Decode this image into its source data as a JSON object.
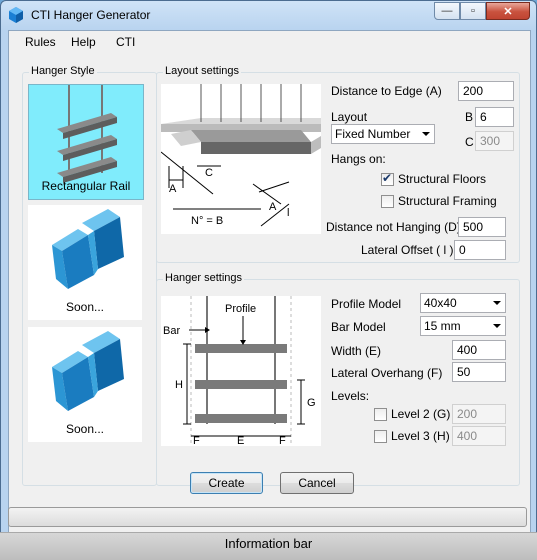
{
  "window": {
    "title": "CTI Hanger Generator",
    "icons": [
      "app-icon",
      "minimize-icon",
      "maximize-icon",
      "close-icon"
    ]
  },
  "menu": {
    "items": [
      "Rules",
      "Help",
      "CTI"
    ]
  },
  "hanger_style": {
    "title": "Hanger Style",
    "tiles": [
      {
        "label": "Rectangular Rail",
        "selected": true
      },
      {
        "label": "Soon...",
        "selected": false
      },
      {
        "label": "Soon...",
        "selected": false
      }
    ],
    "selected_color": "#80ecfc"
  },
  "layout": {
    "title": "Layout settings",
    "diagram_labels": {
      "a1": "A",
      "c": "C",
      "nb": "N° = B",
      "a2": "A",
      "l": "l"
    },
    "distance_edge_label": "Distance to Edge (A)",
    "distance_edge_value": "200",
    "layout_label": "Layout",
    "layout_value": "Fixed Number",
    "b_label": "B",
    "b_value": "6",
    "c_label": "C",
    "c_value": "300",
    "hangs_on_label": "Hangs on:",
    "structural_floors_label": "Structural Floors",
    "structural_floors_checked": true,
    "structural_framing_label": "Structural Framing",
    "structural_framing_checked": false,
    "distance_not_hanging_label": "Distance not Hanging (D)",
    "distance_not_hanging_value": "500",
    "lateral_offset_label": "Lateral Offset ( l )",
    "lateral_offset_value": "0"
  },
  "hanger": {
    "title": "Hanger settings",
    "diagram_labels": {
      "bar": "Bar",
      "profile": "Profile",
      "h": "H",
      "g": "G",
      "f1": "F",
      "e": "E",
      "f2": "F"
    },
    "profile_model_label": "Profile Model",
    "profile_model_value": "40x40",
    "bar_model_label": "Bar Model",
    "bar_model_value": "15 mm",
    "width_label": "Width (E)",
    "width_value": "400",
    "lateral_overhang_label": "Lateral Overhang (F)",
    "lateral_overhang_value": "50",
    "levels_label": "Levels:",
    "level2_label": "Level 2 (G)",
    "level2_value": "200",
    "level2_checked": false,
    "level3_label": "Level 3 (H)",
    "level3_value": "400",
    "level3_checked": false
  },
  "actions": {
    "create_label": "Create",
    "cancel_label": "Cancel"
  },
  "status": {
    "info_label": "Information bar"
  }
}
